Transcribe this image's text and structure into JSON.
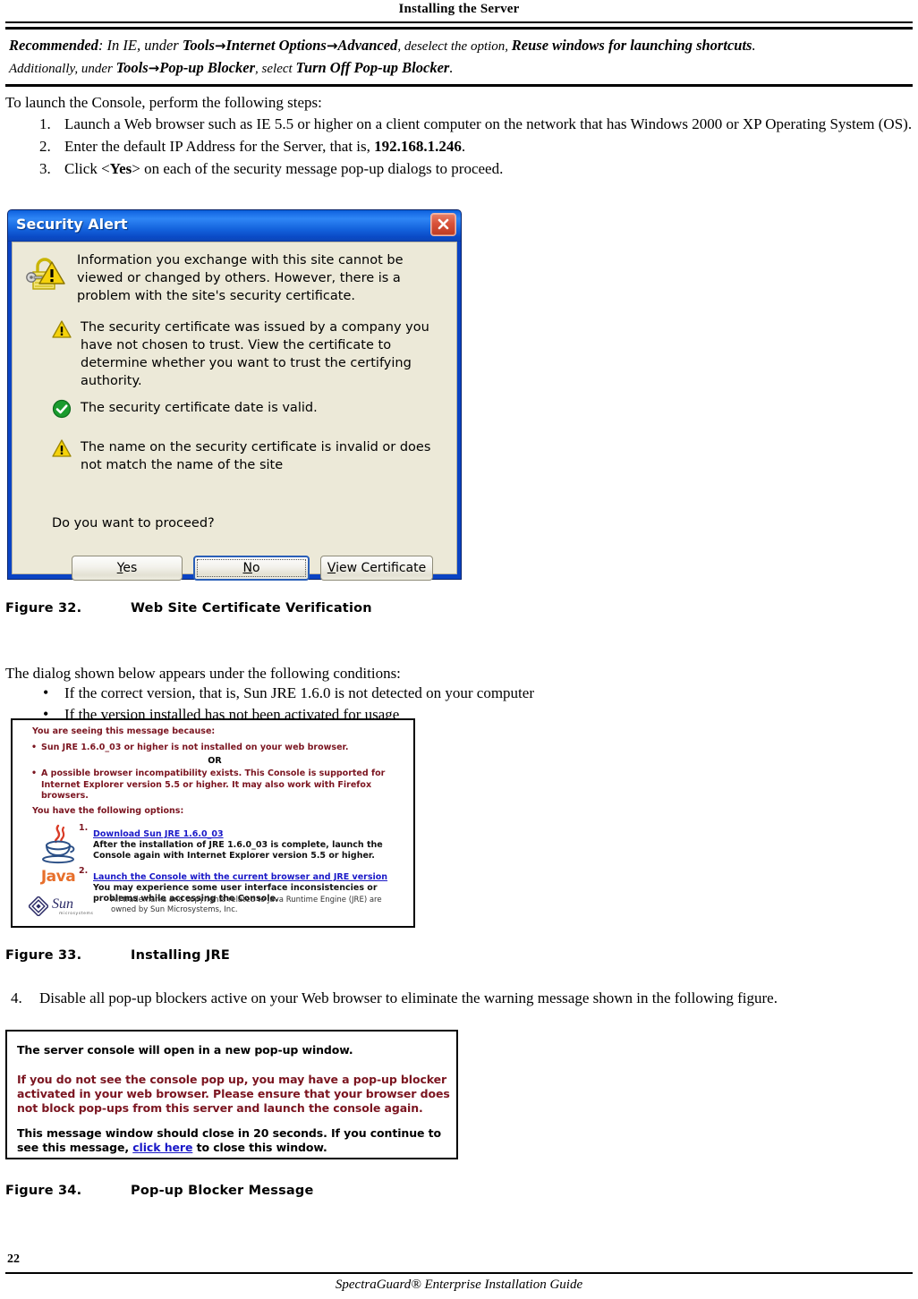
{
  "header": {
    "title": "Installing the Server"
  },
  "recommended": {
    "line1_a": "Recommended",
    "line1_b": ": In IE, under ",
    "line1_tools": "Tools",
    "line1_arrow1": "→",
    "line1_internet_options": "Internet Options",
    "line1_arrow2": "→",
    "line1_advanced": "Advanced",
    "line1_c": ", deselect the option, ",
    "line1_reuse": "Reuse windows for launching shortcuts",
    "line1_d": ".",
    "line2_a": "Additionally, under ",
    "line2_tools": "Tools",
    "line2_arrow": "→",
    "line2_popup": "Pop-up Blocker",
    "line2_b": ", select ",
    "line2_turnoff": "Turn Off Pop-up Blocker",
    "line2_c": "."
  },
  "intro": "To launch the Console, perform the following steps:",
  "steps": [
    {
      "num": "1.",
      "text_a": "Launch a Web browser such as IE 5.5 or higher on a client computer on the network that has Windows 2000 or XP Operating System (OS).",
      "bold": "",
      "text_b": ""
    },
    {
      "num": "2.",
      "text_a": "Enter the default IP Address for the Server, that is, ",
      "bold": "192.168.1.246",
      "text_b": "."
    },
    {
      "num": "3.",
      "text_a": "Click <",
      "bold": "Yes",
      "text_b": "> on each of the security message pop-up dialogs to proceed."
    }
  ],
  "security_alert": {
    "title": "Security Alert",
    "close_label": "Close",
    "intro": "Information you exchange with this site cannot be viewed or changed by others. However, there is a problem with the site's security certificate.",
    "items": [
      {
        "icon": "warning-icon",
        "text": "The security certificate was issued by a company you have not chosen to trust. View the certificate to determine whether you want to trust the certifying authority."
      },
      {
        "icon": "check-icon",
        "text": "The security certificate date is valid."
      },
      {
        "icon": "warning-icon",
        "text": "The name on the security certificate is invalid or does not match the name of the site"
      }
    ],
    "question": "Do you want to proceed?",
    "buttons": [
      {
        "label_pre": "",
        "accel": "Y",
        "label_post": "es",
        "default": false
      },
      {
        "label_pre": "",
        "accel": "N",
        "label_post": "o",
        "default": true
      },
      {
        "label_pre": "",
        "accel": "V",
        "label_post": "iew Certificate",
        "default": false
      }
    ]
  },
  "figure32": {
    "label": "Figure  32.",
    "title": "Web Site Certificate Verification"
  },
  "conditions": {
    "intro": "The dialog shown below appears under the following conditions:",
    "items": [
      "If the correct version, that is, Sun JRE 1.6.0 is not detected on your computer",
      "If the version installed has not been activated for usage"
    ]
  },
  "jre_dialog": {
    "heading1": "You are seeing this message because:",
    "bullet1": "Sun JRE 1.6.0_03 or higher is not installed on your web browser.",
    "or": "OR",
    "bullet2": "A possible browser incompatibility exists. This Console is supported for Internet Explorer version 5.5 or higher. It may also work with Firefox browsers.",
    "heading2": "You have the following options:",
    "option1": {
      "num": "1.",
      "link": "Download Sun JRE 1.6.0_03",
      "desc": "After the installation of JRE 1.6.0_03 is complete, launch the Console again with Internet Explorer version 5.5 or higher."
    },
    "option2": {
      "num": "2.",
      "link": "Launch the Console with the current browser and JRE version",
      "desc": "You may experience some user interface inconsistencies or problems while accessing the Console."
    },
    "java_wordmark": "Java",
    "sun_wordmark": "Sun",
    "sun_subtext": "microsystems",
    "trademark": "All trademarks and copyrights related to Java Runtime Engine (JRE) are owned by Sun Microsystems, Inc."
  },
  "figure33": {
    "label": "Figure  33.",
    "title": "Installing JRE"
  },
  "step4": {
    "num": "4.",
    "text": "Disable all pop-up blockers active on your Web browser to eliminate the warning message shown in the following figure."
  },
  "popup_message": {
    "line1": "The server console will open in a new pop-up window.",
    "red_line1": "If you do not see the console pop up, you may have a pop-up blocker",
    "red_line2": "activated in your web browser. Please ensure that your browser does",
    "red_line3": "not block pop-ups from this server and launch the console again.",
    "line2_a": "This message window should close in 20 seconds. If you continue to",
    "line3_a": "see this message, ",
    "link": "click here",
    "line3_b": " to close this window."
  },
  "figure34": {
    "label": "Figure  34.",
    "title": "Pop-up Blocker Message"
  },
  "footer": {
    "page_number": "22",
    "text_a": "SpectraGuard",
    "reg": "®",
    "text_b": " Enterprise Installation Guide"
  },
  "colors": {
    "titlebar_blue": "#1463dd",
    "close_red": "#d9523a",
    "dialog_face": "#ece9d8",
    "jre_maroon": "#7b1520",
    "link_blue": "#1a19c8",
    "java_orange": "#e76f2b",
    "warning_yellow": "#f5d20c",
    "ok_green": "#1a9b2e"
  }
}
